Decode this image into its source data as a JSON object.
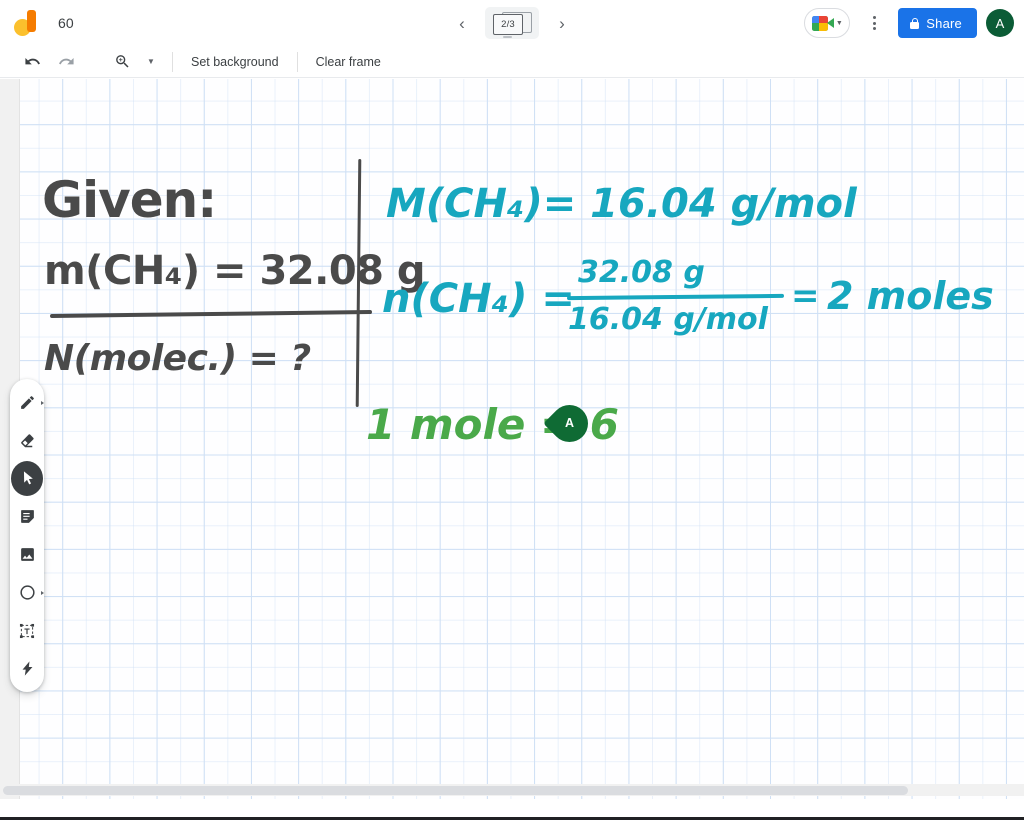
{
  "app": {
    "logo_icon": "jamboard-logo-icon",
    "title": "60"
  },
  "frame_nav": {
    "prev_icon": "chevron-left-icon",
    "next_icon": "chevron-right-icon",
    "counter": "2/3"
  },
  "topbar_right": {
    "meet_icon": "google-meet-icon",
    "meet_caret_icon": "chevron-down-icon",
    "more_icon": "more-vertical-icon",
    "share_label": "Share",
    "share_lock_icon": "lock-icon",
    "share_bg": "#1a73e8",
    "avatar_initial": "A",
    "avatar_bg": "#0b5c36"
  },
  "toolbar": {
    "undo_icon": "undo-icon",
    "redo_icon": "redo-icon",
    "zoom_icon": "zoom-in-icon",
    "zoom_caret_icon": "chevron-down-icon",
    "set_background_label": "Set background",
    "clear_frame_label": "Clear frame"
  },
  "palette": {
    "items": [
      {
        "name": "pen-tool",
        "icon": "pen-icon",
        "active": false,
        "has_caret": true
      },
      {
        "name": "eraser-tool",
        "icon": "eraser-icon",
        "active": false,
        "has_caret": false
      },
      {
        "name": "select-tool",
        "icon": "cursor-arrow-icon",
        "active": true,
        "has_caret": false
      },
      {
        "name": "sticky-note-tool",
        "icon": "sticky-note-icon",
        "active": false,
        "has_caret": false
      },
      {
        "name": "image-tool",
        "icon": "image-icon",
        "active": false,
        "has_caret": false
      },
      {
        "name": "shape-tool",
        "icon": "circle-shape-icon",
        "active": false,
        "has_caret": true
      },
      {
        "name": "text-box-tool",
        "icon": "text-box-icon",
        "active": false,
        "has_caret": false
      },
      {
        "name": "laser-pointer-tool",
        "icon": "laser-pointer-icon",
        "active": false,
        "has_caret": false
      }
    ]
  },
  "canvas": {
    "background": "graph-grid",
    "grid_color": "#cfe0f5",
    "ink_colors": {
      "dark": "#4a4a4a",
      "teal": "#17a7bf",
      "green": "#4aa94a"
    },
    "handwriting": {
      "given_label": "Given:",
      "given_mass": "m(CH₄) = 32.08 g",
      "unknown": "N(molec.) = ?",
      "molar_mass": "M(CH₄)= 16.04 g/mol",
      "moles_lhs": "n(CH₄) =",
      "fraction_numerator": "32.08 g",
      "fraction_denominator": "16.04 g/mol",
      "moles_equals": "=",
      "moles_result": "2 moles",
      "avogadro_line": "1 mole = 6"
    }
  },
  "collaborator": {
    "initial": "A",
    "color": "#0f6b34"
  },
  "scrollbar": {
    "orientation": "horizontal"
  }
}
